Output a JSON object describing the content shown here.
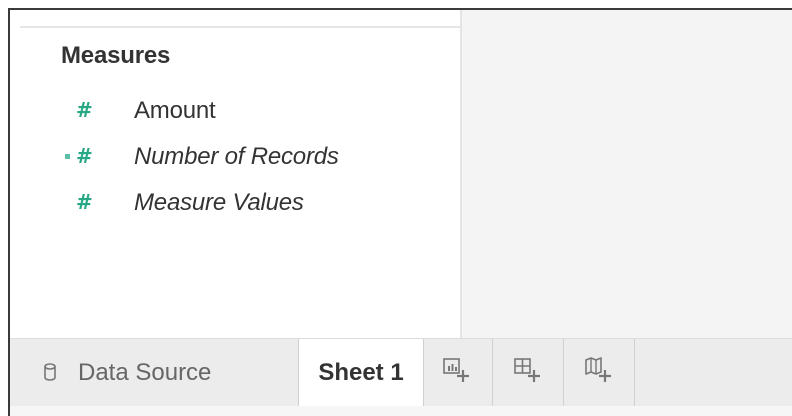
{
  "data_pane": {
    "section_title": "Measures",
    "fields": [
      {
        "name": "Amount",
        "italic": false,
        "icon": "number-icon"
      },
      {
        "name": "Number of Records",
        "italic": true,
        "icon": "number-icon"
      },
      {
        "name": "Measure Values",
        "italic": true,
        "icon": "number-icon"
      }
    ]
  },
  "tabbar": {
    "data_source_label": "Data Source",
    "sheet_label": "Sheet 1",
    "buttons": [
      "new-worksheet-icon",
      "new-dashboard-icon",
      "new-story-icon"
    ]
  },
  "colors": {
    "measure_green": "#26a886",
    "canvas_bg": "#f4f4f4",
    "tabbar_bg": "#ececec"
  }
}
